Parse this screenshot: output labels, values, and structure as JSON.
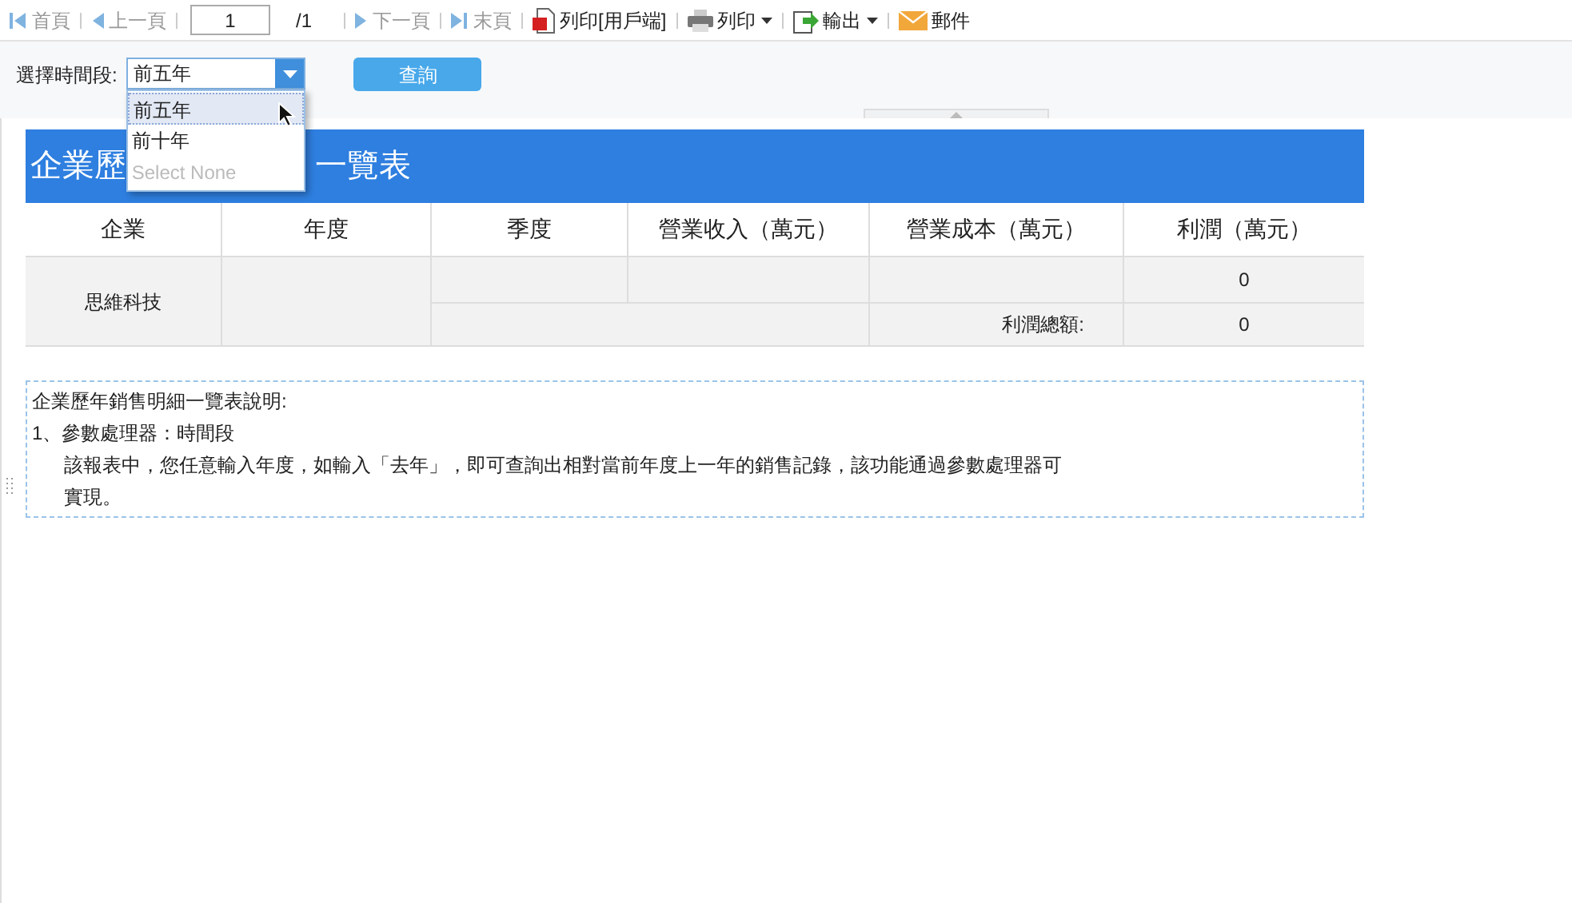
{
  "toolbar": [
    {
      "kind": "first",
      "label": "首頁",
      "disabled": true
    },
    {
      "kind": "prev",
      "label": "上一頁",
      "disabled": true
    },
    {
      "kind": "page",
      "value": "1",
      "total": "/1"
    },
    {
      "kind": "next",
      "label": "下一頁",
      "disabled": true
    },
    {
      "kind": "last",
      "label": "末頁",
      "disabled": true
    },
    {
      "kind": "pdf",
      "label": "列印[用戶端]",
      "disabled": false
    },
    {
      "kind": "printer",
      "label": "列印",
      "disabled": false,
      "menu": true
    },
    {
      "kind": "export",
      "label": "輸出",
      "disabled": false,
      "menu": true
    },
    {
      "kind": "mail",
      "label": "郵件",
      "disabled": false
    }
  ],
  "params": {
    "label": "選擇時間段:",
    "value": "前五年",
    "expanded": true,
    "options": [
      {
        "label": "前五年",
        "selected": true,
        "kind": "option"
      },
      {
        "label": "前十年",
        "selected": false,
        "kind": "option"
      },
      {
        "label": "Select None",
        "selected": false,
        "kind": "none"
      }
    ],
    "query_button": "查詢"
  },
  "report": {
    "title_parts": [
      "企業歷",
      "一覽表"
    ],
    "columns": [
      "企業",
      "年度",
      "季度",
      "營業收入（萬元）",
      "營業成本（萬元）",
      "利潤（萬元）"
    ],
    "company": "思維科技",
    "profit": "0",
    "total_label": "利潤總額:",
    "total": "0"
  },
  "notes": {
    "title": "企業歷年銷售明細一覽表說明:",
    "item": "1、參數處理器：時間段",
    "body": "該報表中，您任意輸入年度，如輸入「去年」，即可查詢出相對當前年度上一年的銷售記錄，該功能通過參數處理器可",
    "body_cont": "實現。"
  }
}
